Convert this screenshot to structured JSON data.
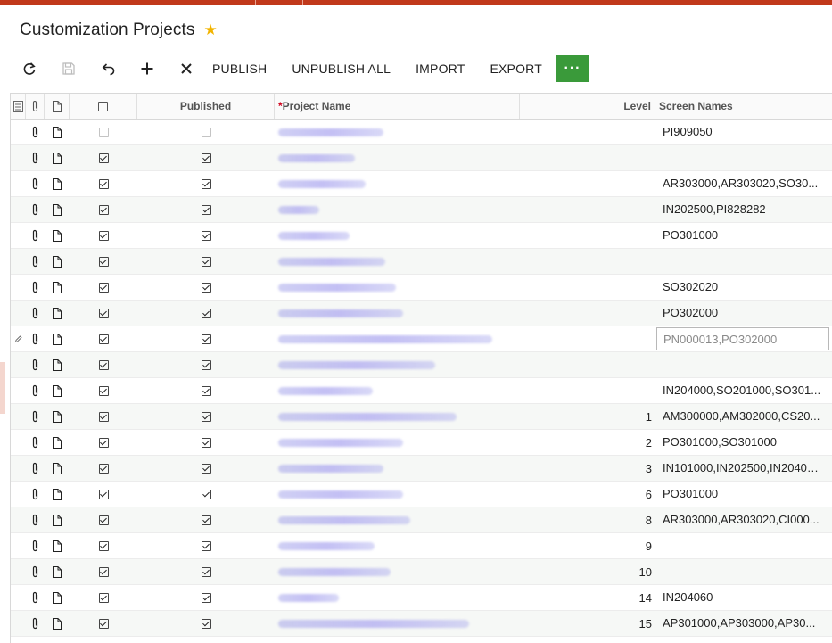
{
  "page": {
    "title": "Customization Projects",
    "favorite_icon": "star-icon",
    "accent_color": "#c1391b",
    "star_color": "#f2b400",
    "more_button_color": "#3a9a3a"
  },
  "toolbar": {
    "icons": [
      "refresh-icon",
      "save-icon",
      "undo-icon",
      "add-icon",
      "delete-icon"
    ],
    "publish_label": "PUBLISH",
    "unpublish_all_label": "UNPUBLISH ALL",
    "import_label": "IMPORT",
    "export_label": "EXPORT",
    "more_label": "···"
  },
  "grid": {
    "columns": {
      "published": "Published",
      "required_mark": "*",
      "project_name": "Project Name",
      "level": "Level",
      "screen_names": "Screen Names"
    },
    "rows": [
      {
        "selected": false,
        "published": false,
        "level": "",
        "screens": "PI909050"
      },
      {
        "selected": true,
        "published": true,
        "level": "",
        "screens": ""
      },
      {
        "selected": true,
        "published": true,
        "level": "",
        "screens": "AR303000,AR303020,SO30..."
      },
      {
        "selected": true,
        "published": true,
        "level": "",
        "screens": "IN202500,PI828282"
      },
      {
        "selected": true,
        "published": true,
        "level": "",
        "screens": "PO301000"
      },
      {
        "selected": true,
        "published": true,
        "level": "",
        "screens": ""
      },
      {
        "selected": true,
        "published": true,
        "level": "",
        "screens": "SO302020"
      },
      {
        "selected": true,
        "published": true,
        "level": "",
        "screens": "PO302000"
      },
      {
        "selected": true,
        "published": true,
        "level": "",
        "screens": "PN000013,PO302000",
        "editing": true
      },
      {
        "selected": true,
        "published": true,
        "level": "",
        "screens": ""
      },
      {
        "selected": true,
        "published": true,
        "level": "",
        "screens": "IN204000,SO201000,SO301..."
      },
      {
        "selected": true,
        "published": true,
        "level": "1",
        "screens": "AM300000,AM302000,CS20..."
      },
      {
        "selected": true,
        "published": true,
        "level": "2",
        "screens": "PO301000,SO301000"
      },
      {
        "selected": true,
        "published": true,
        "level": "3",
        "screens": "IN101000,IN202500,IN20400..."
      },
      {
        "selected": true,
        "published": true,
        "level": "6",
        "screens": "PO301000"
      },
      {
        "selected": true,
        "published": true,
        "level": "8",
        "screens": "AR303000,AR303020,CI000..."
      },
      {
        "selected": true,
        "published": true,
        "level": "9",
        "screens": ""
      },
      {
        "selected": true,
        "published": true,
        "level": "10",
        "screens": ""
      },
      {
        "selected": true,
        "published": true,
        "level": "14",
        "screens": "IN204060"
      },
      {
        "selected": true,
        "published": true,
        "level": "15",
        "screens": "AP301000,AP303000,AP30..."
      }
    ]
  }
}
